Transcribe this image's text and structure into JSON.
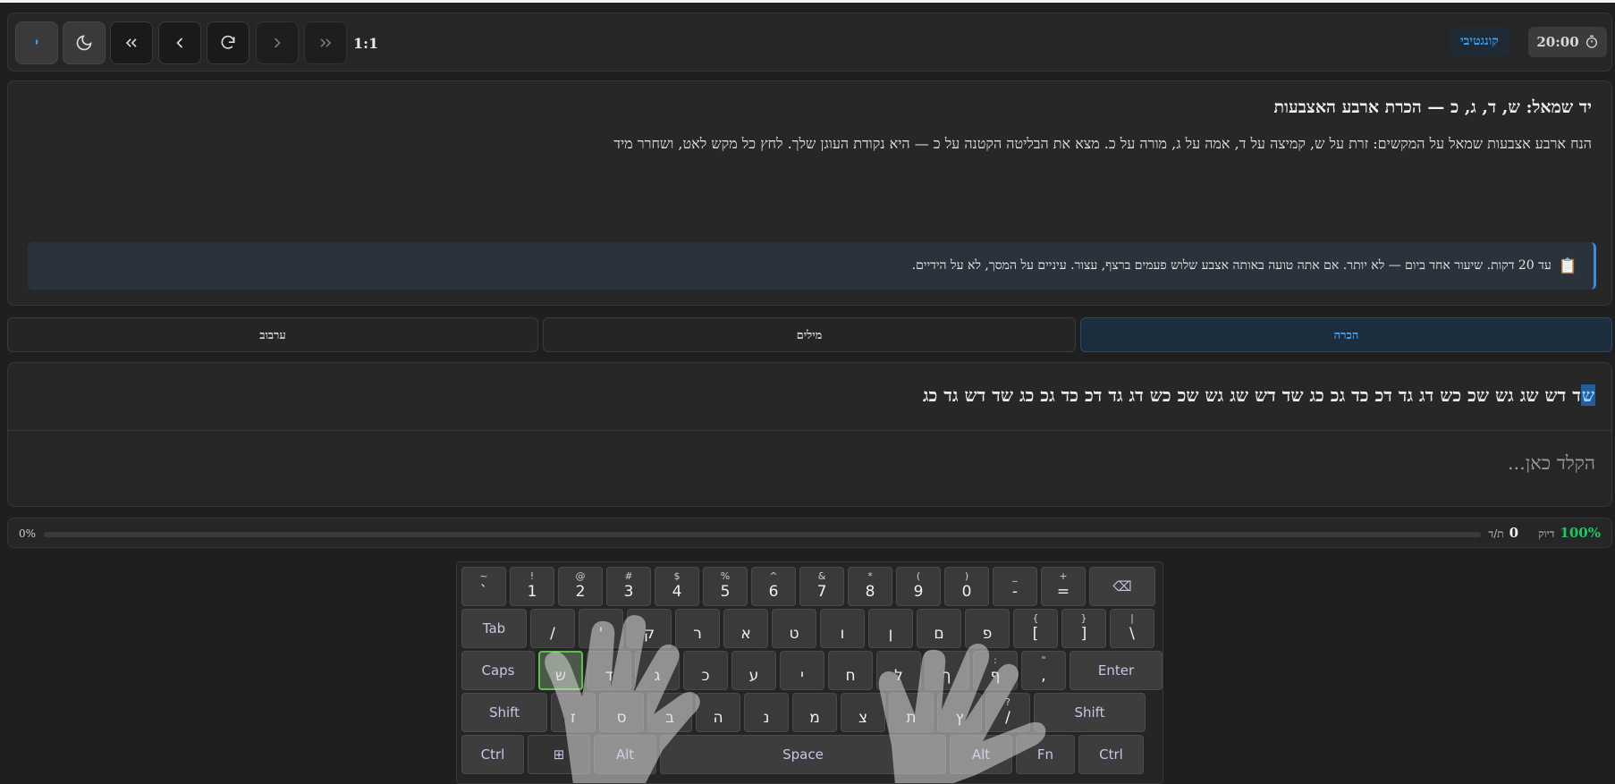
{
  "toolbar": {
    "lang_button": "י",
    "ratio": "1:1",
    "mode_badge": "קונגטיבי",
    "timer": "20:00"
  },
  "lesson": {
    "title": "יד שמאל: ש, ד, ג, כ — הכרת ארבע האצבעות",
    "description": "הנח ארבע אצבעות שמאל על המקשים: זרת על ש, קמיצה על ד, אמה על ג, מורה על כ. מצא את הבליטה הקטנה על כ — היא נקודת העוגן שלך. לחץ כל מקש לאט, ושחרר מיד",
    "note_icon": "📋",
    "note": "עד 20 דקות. שיעור אחד ביום — לא יותר. אם אתה טועה באותה אצבע שלוש פעמים ברצף, עצור. עיניים על המסך, לא על הידיים."
  },
  "tabs": [
    {
      "label": "הכרה",
      "active": true
    },
    {
      "label": "מילים",
      "active": false
    },
    {
      "label": "ערבוב",
      "active": false
    }
  ],
  "practice": {
    "current_char": "ש",
    "target_rest": "ד דש שג גש שכ כש דג גד דכ כד גכ כג שד דש שג גש שכ כש דג גד דכ כד גכ כג שד דש גד כג",
    "input_placeholder": "הקלד כאן..."
  },
  "stats": {
    "progress_label": "0%",
    "progress": 0,
    "wpm_value": "0",
    "wpm_label": "ת/ד",
    "accuracy_label": "דיוק",
    "accuracy_value": "100%"
  },
  "keyboard": {
    "row1": [
      {
        "shift": "~",
        "main": "`"
      },
      {
        "shift": "!",
        "main": "1"
      },
      {
        "shift": "@",
        "main": "2"
      },
      {
        "shift": "#",
        "main": "3"
      },
      {
        "shift": "$",
        "main": "4"
      },
      {
        "shift": "%",
        "main": "5"
      },
      {
        "shift": "^",
        "main": "6"
      },
      {
        "shift": "&",
        "main": "7"
      },
      {
        "shift": "*",
        "main": "8"
      },
      {
        "shift": "(",
        "main": "9"
      },
      {
        "shift": ")",
        "main": "0"
      },
      {
        "shift": "_",
        "main": "-"
      },
      {
        "shift": "+",
        "main": "="
      }
    ],
    "row2_label": "Tab",
    "row2": [
      {
        "shift": "",
        "main": "/"
      },
      {
        "shift": "",
        "main": "'"
      },
      {
        "shift": "",
        "main": "ק"
      },
      {
        "shift": "",
        "main": "ר"
      },
      {
        "shift": "",
        "main": "א"
      },
      {
        "shift": "",
        "main": "ט"
      },
      {
        "shift": "",
        "main": "ו"
      },
      {
        "shift": "",
        "main": "ן"
      },
      {
        "shift": "",
        "main": "ם"
      },
      {
        "shift": "",
        "main": "פ"
      },
      {
        "shift": "{",
        "main": "["
      },
      {
        "shift": "}",
        "main": "]"
      },
      {
        "shift": "|",
        "main": "\\"
      }
    ],
    "row3_label": "Caps",
    "row3_enter": "Enter",
    "row3": [
      {
        "shift": "",
        "main": "ש"
      },
      {
        "shift": "",
        "main": "ד"
      },
      {
        "shift": "",
        "main": "ג"
      },
      {
        "shift": "",
        "main": "כ"
      },
      {
        "shift": "",
        "main": "ע"
      },
      {
        "shift": "",
        "main": "י"
      },
      {
        "shift": "",
        "main": "ח"
      },
      {
        "shift": "",
        "main": "ל"
      },
      {
        "shift": "",
        "main": "ך"
      },
      {
        "shift": ":",
        "main": "ף"
      },
      {
        "shift": "\"",
        "main": ","
      }
    ],
    "row4_left": "Shift",
    "row4_right": "Shift",
    "row4": [
      {
        "shift": "",
        "main": "ז"
      },
      {
        "shift": "",
        "main": "ס"
      },
      {
        "shift": "",
        "main": "ב"
      },
      {
        "shift": "",
        "main": "ה"
      },
      {
        "shift": "",
        "main": "נ"
      },
      {
        "shift": "",
        "main": "מ"
      },
      {
        "shift": "",
        "main": "צ"
      },
      {
        "shift": "",
        "main": "ת"
      },
      {
        "shift": "",
        "main": "ץ"
      },
      {
        "shift": "?",
        "main": "/"
      }
    ],
    "row5": {
      "ctrl_left": "Ctrl",
      "win": "⊞",
      "alt_left": "Alt",
      "space": "Space",
      "alt_right": "Alt",
      "fn": "Fn",
      "ctrl_right": "Ctrl"
    },
    "highlighted_key": "ש"
  },
  "colors": {
    "accent": "#3b9cf0",
    "accuracy": "#22c55e",
    "home_key": "#5fbf4e"
  }
}
